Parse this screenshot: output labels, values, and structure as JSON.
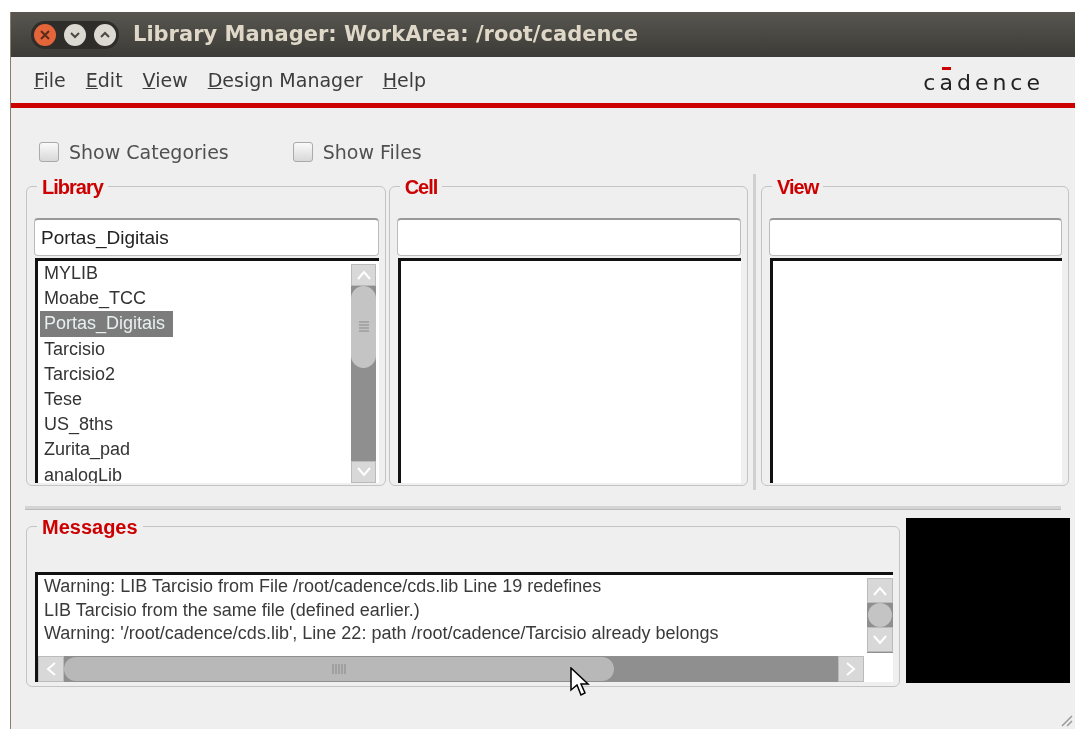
{
  "window": {
    "title": "Library Manager: WorkArea: /root/cadence"
  },
  "menu": [
    {
      "label": "File"
    },
    {
      "label": "Edit"
    },
    {
      "label": "View"
    },
    {
      "label": "Design Manager"
    },
    {
      "label": "Help"
    }
  ],
  "logo": "cadence",
  "options": [
    {
      "label": "Show Categories",
      "checked": false
    },
    {
      "label": "Show Files",
      "checked": false
    }
  ],
  "panes": [
    {
      "title": "Library",
      "filter": "Portas_Digitais",
      "items": [
        {
          "label": "MYLIB",
          "selected": false
        },
        {
          "label": "Moabe_TCC",
          "selected": false
        },
        {
          "label": "Portas_Digitais",
          "selected": true
        },
        {
          "label": "Tarcisio",
          "selected": false
        },
        {
          "label": "Tarcisio2",
          "selected": false
        },
        {
          "label": "Tese",
          "selected": false
        },
        {
          "label": "US_8ths",
          "selected": false
        },
        {
          "label": "Zurita_pad",
          "selected": false
        },
        {
          "label": "analogLib",
          "selected": false
        }
      ]
    },
    {
      "title": "Cell"
    },
    {
      "title": "View"
    }
  ],
  "messages": {
    "title": "Messages",
    "lines": [
      "Warning: LIB Tarcisio from File /root/cadence/cds.lib Line 19 redefines",
      "LIB Tarcisio from the same file (defined earlier.)",
      "Warning: '/root/cadence/cds.lib', Line 22: path /root/cadence/Tarcisio already belongs"
    ]
  }
}
